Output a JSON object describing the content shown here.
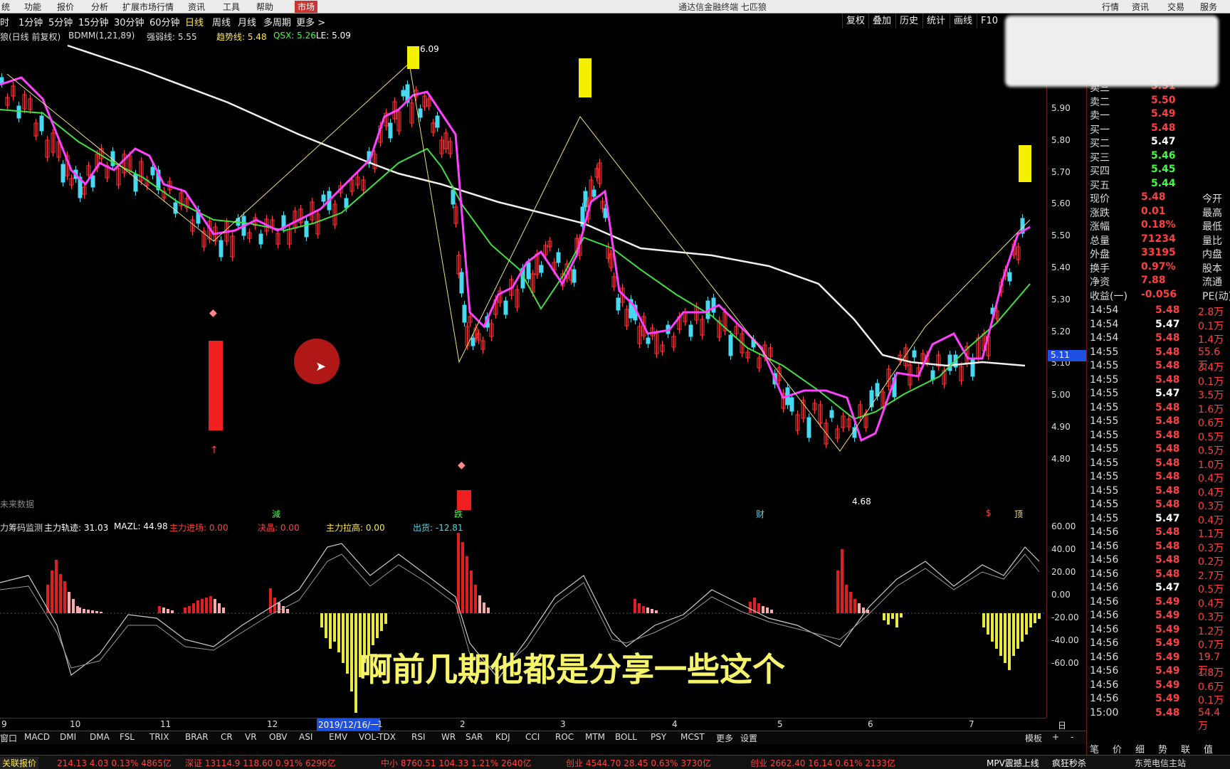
{
  "window": {
    "app_title": "通达信金融终端 七匹狼",
    "menu": [
      "统",
      "功能",
      "报价",
      "分析",
      "扩展市场行情",
      "资讯",
      "工具",
      "帮助",
      "市场"
    ],
    "right_menu": [
      "行情",
      "资讯",
      "交易",
      "服务"
    ]
  },
  "toolbar": {
    "periods": [
      "时",
      "1分钟",
      "5分钟",
      "15分钟",
      "30分钟",
      "60分钟",
      "日线",
      "周线",
      "月线",
      "多周期",
      "更多 >"
    ],
    "active": "日线",
    "right_buttons": [
      "复权",
      "叠加",
      "历史",
      "统计",
      "画线",
      "F10"
    ]
  },
  "infobar": {
    "title": "狼(日线 前复权)",
    "bdmm": "BDMM(1,21,89)",
    "strong_weak": "强弱线: 5.55",
    "trend": "趋势线: 5.48",
    "qsx": "QSX: 5.26",
    "le": "LE: 5.09"
  },
  "chart_labels": {
    "high": "6.09",
    "low": "4.68",
    "no_data": "未来数据",
    "current_tag": "5.11",
    "markers": [
      "減",
      "跌",
      "财",
      "$",
      "顶"
    ]
  },
  "price_axis": [
    "5.90",
    "5.80",
    "5.70",
    "5.60",
    "5.50",
    "5.40",
    "5.30",
    "5.20",
    "5.10",
    "5.00",
    "4.90",
    "4.80"
  ],
  "indicator": {
    "name": "力筹码监测",
    "track": "主力轨迹: 31.03",
    "mazl": "MAZL: 44.98",
    "enter": "主力进场: 0.00",
    "decide": "决晶: 0.00",
    "pull": "主力拉高: 0.00",
    "out": "出货: -12.81",
    "axis": [
      "60.00",
      "40.00",
      "20.00",
      "0.00",
      "-20.00",
      "-40.00",
      "-60.00"
    ]
  },
  "date_axis": {
    "labels": [
      "9",
      "10",
      "11",
      "12",
      "2019/12/16/一",
      "1",
      "2",
      "3",
      "4",
      "5",
      "6",
      "7"
    ],
    "right": "日线"
  },
  "bottom_tabs": [
    "窗口",
    "MACD",
    "DMI",
    "DMA",
    "FSL",
    "TRIX",
    "BRAR",
    "CR",
    "VR",
    "OBV",
    "ASI",
    "EMV",
    "VOL-TDX",
    "RSI",
    "WR",
    "SAR",
    "KDJ",
    "CCI",
    "ROC",
    "MTM",
    "BOLL",
    "PSY",
    "MCST",
    "更多",
    "设置"
  ],
  "bottom_right_tabs": [
    "模板",
    "+",
    "-"
  ],
  "status_bar": {
    "left": "关联报价",
    "index1": "214.13  4.03  0.13%  4865亿",
    "index2": "深证 13114.9  118.60  0.91%  6296亿",
    "index3": "中小 8760.51  104.33  1.21%  2640亿",
    "index4": "创业 4544.70  28.45  0.63%  3730亿",
    "index5": "创业 2662.40  16.14  0.61%  2133亿",
    "right1": "MPV震撼上线",
    "right2": "疯狂秒杀",
    "right3": "东莞电信主站"
  },
  "quote": {
    "asks": [
      {
        "label": "卖三",
        "price": "5.51"
      },
      {
        "label": "卖二",
        "price": "5.50"
      },
      {
        "label": "卖一",
        "price": "5.49"
      }
    ],
    "bids": [
      {
        "label": "买一",
        "price": "5.48"
      },
      {
        "label": "买二",
        "price": "5.47"
      },
      {
        "label": "买三",
        "price": "5.46"
      },
      {
        "label": "买四",
        "price": "5.45"
      },
      {
        "label": "买五",
        "price": "5.44"
      }
    ],
    "stats": [
      {
        "l1": "现价",
        "v1": "5.48",
        "l2": "今开"
      },
      {
        "l1": "涨跌",
        "v1": "0.01",
        "l2": "最高"
      },
      {
        "l1": "涨幅",
        "v1": "0.18%",
        "l2": "最低"
      },
      {
        "l1": "总量",
        "v1": "71234",
        "l2": "量比"
      },
      {
        "l1": "外盘",
        "v1": "33195",
        "l2": "内盘"
      },
      {
        "l1": "换手",
        "v1": "0.97%",
        "l2": "股本"
      },
      {
        "l1": "净资",
        "v1": "7.88",
        "l2": "流通"
      },
      {
        "l1": "收益(一)",
        "v1": "-0.056",
        "l2": "PE(动)"
      }
    ],
    "ticks": [
      [
        "14:54",
        "5.48",
        "2.8万"
      ],
      [
        "14:54",
        "5.47",
        "0.1万"
      ],
      [
        "14:54",
        "5.48",
        "1.4万"
      ],
      [
        "14:55",
        "5.48",
        "55.6万"
      ],
      [
        "14:55",
        "5.48",
        "3.4万"
      ],
      [
        "14:55",
        "5.48",
        "0.1万"
      ],
      [
        "14:55",
        "5.47",
        "3.5万"
      ],
      [
        "14:55",
        "5.48",
        "1.6万"
      ],
      [
        "14:55",
        "5.48",
        "0.6万"
      ],
      [
        "14:55",
        "5.48",
        "0.5万"
      ],
      [
        "14:55",
        "5.48",
        "0.5万"
      ],
      [
        "14:55",
        "5.48",
        "1.0万"
      ],
      [
        "14:55",
        "5.48",
        "0.4万"
      ],
      [
        "14:55",
        "5.48",
        "0.4万"
      ],
      [
        "14:55",
        "5.48",
        "0.3万"
      ],
      [
        "14:55",
        "5.47",
        "0.4万"
      ],
      [
        "14:56",
        "5.48",
        "1.1万"
      ],
      [
        "14:56",
        "5.48",
        "0.3万"
      ],
      [
        "14:56",
        "5.48",
        "0.2万"
      ],
      [
        "14:56",
        "5.48",
        "2.7万"
      ],
      [
        "14:56",
        "5.47",
        "0.5万"
      ],
      [
        "14:56",
        "5.49",
        "0.4万"
      ],
      [
        "14:56",
        "5.49",
        "0.3万"
      ],
      [
        "14:56",
        "5.49",
        "1.2万"
      ],
      [
        "14:56",
        "5.49",
        "0.7万"
      ],
      [
        "14:56",
        "5.49",
        "19.7万"
      ],
      [
        "14:56",
        "5.49",
        "1.8万"
      ],
      [
        "14:56",
        "5.49",
        "0.6万"
      ],
      [
        "14:56",
        "5.49",
        "0.1万"
      ],
      [
        "15:00",
        "5.48",
        "54.4万"
      ]
    ],
    "bottom_tabs": [
      "笔",
      "价",
      "细",
      "势",
      "联",
      "值"
    ]
  },
  "subtitle": "啊前几期他都是分享一些这个",
  "colors": {
    "red": "#ff3030",
    "green": "#40ff40",
    "yellow": "#ffe84a",
    "cyan": "#4ad7f0",
    "magenta": "#ff40ff"
  }
}
